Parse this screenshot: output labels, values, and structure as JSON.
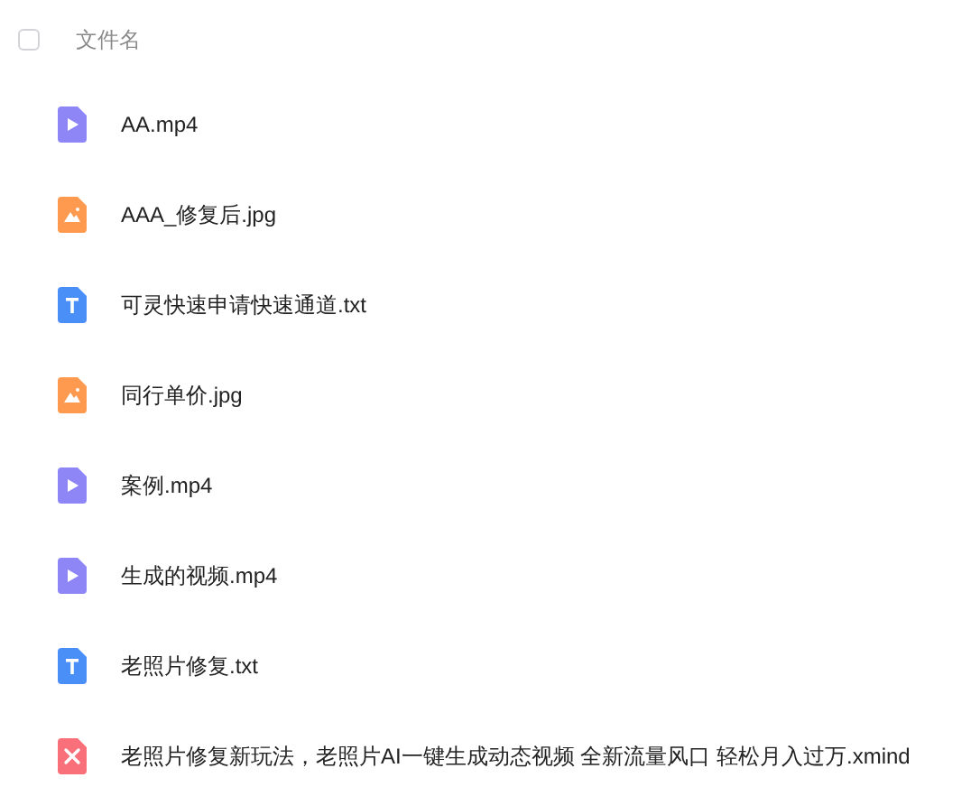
{
  "header": {
    "checked": false,
    "label": "文件名"
  },
  "files": [
    {
      "name": "AA.mp4",
      "kind": "video"
    },
    {
      "name": "AAA_修复后.jpg",
      "kind": "image"
    },
    {
      "name": "可灵快速申请快速通道.txt",
      "kind": "text"
    },
    {
      "name": "同行单价.jpg",
      "kind": "image"
    },
    {
      "name": "案例.mp4",
      "kind": "video"
    },
    {
      "name": "生成的视频.mp4",
      "kind": "video"
    },
    {
      "name": "老照片修复.txt",
      "kind": "text"
    },
    {
      "name": "老照片修复新玩法，老照片AI一键生成动态视频 全新流量风口 轻松月入过万.xmind",
      "kind": "mind"
    }
  ]
}
